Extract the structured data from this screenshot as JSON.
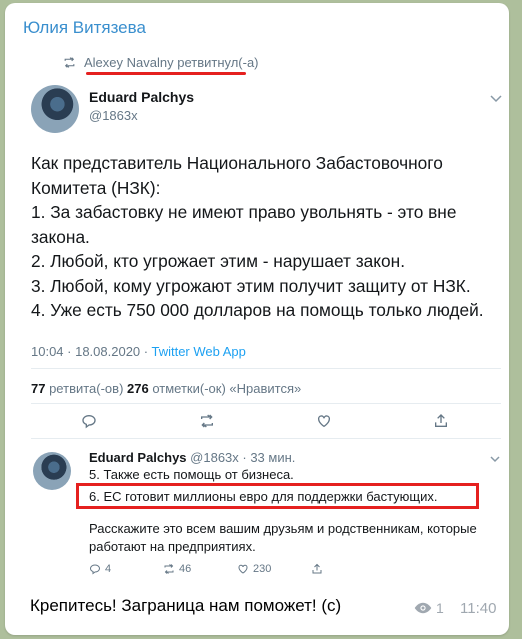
{
  "message": {
    "sender": "Юлия Витязева",
    "caption": "Крепитесь! Заграница нам поможет! (с)",
    "views": "1",
    "time": "11:40"
  },
  "retweet": {
    "text": "Alexey Navalny ретвитнул(-а)"
  },
  "tweet": {
    "author_name": "Eduard Palchys",
    "author_handle": "@1863x",
    "lines": [
      "Как представитель Национального Забастовочного",
      "Комитета (НЗК):",
      "1. За забастовку не имеют право увольнять - это вне",
      "закона.",
      "2. Любой, кто угрожает этим - нарушает закон.",
      "3. Любой, кому угрожают этим получит защиту от НЗК.",
      "4. Уже есть 750 000 долларов на помощь только людей."
    ],
    "timestamp": "10:04 · 18.08.2020 · ",
    "source": "Twitter Web App",
    "retweets_count": "77",
    "retweets_label": " ретвита(-ов)  ",
    "likes_count": "276",
    "likes_label": " отметки(-ок) «Нравится»"
  },
  "reply": {
    "author_name": "Eduard Palchys",
    "author_handle_time": " @1863x · 33 мин.",
    "line1": "5. Также есть помощь от бизнеса.",
    "line2": "6. ЕС готовит миллионы евро для поддержки бастующих.",
    "line3": "Расскажите это всем вашим друзьям и родственникам, которые",
    "line4": "работают на предприятиях.",
    "replies": "4",
    "retweets": "46",
    "likes": "230"
  },
  "colors": {
    "accent": "#3a8fce",
    "twitter_blue": "#1da1f2",
    "highlight_red": "#e5201f",
    "muted": "#657786",
    "chat_bg": "#aebf9c"
  },
  "icons": [
    "retweet-icon",
    "chevron-down-icon",
    "reply-icon",
    "like-icon",
    "share-icon",
    "eye-icon"
  ]
}
